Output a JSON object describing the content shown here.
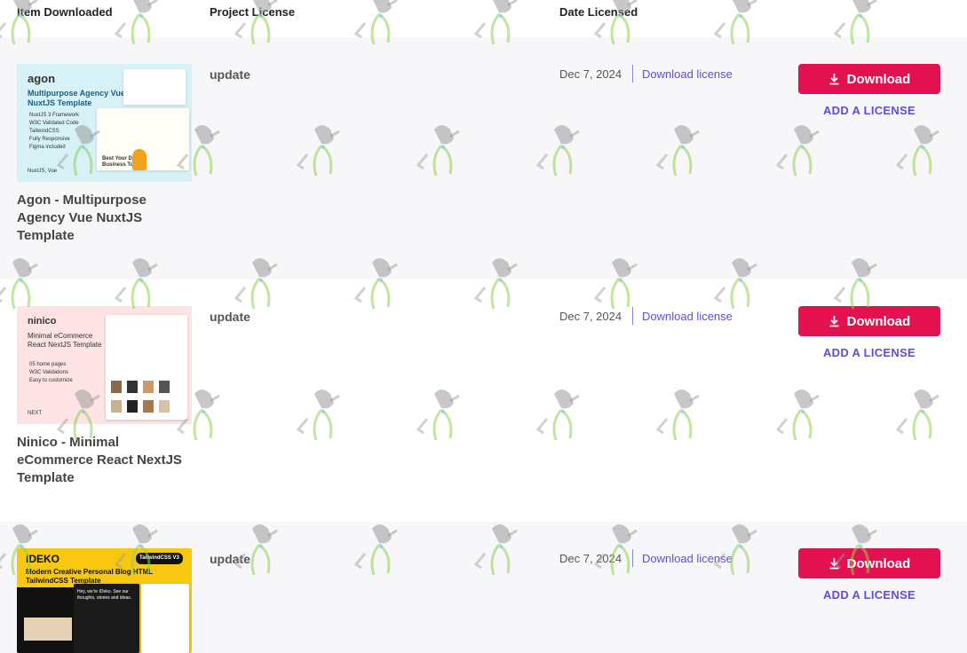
{
  "header": {
    "item_downloaded": "Item Downloaded",
    "project_license": "Project License",
    "date_licensed": "Date Licensed"
  },
  "rows": [
    {
      "title": "Agon - Multipurpose Agency Vue NuxtJS Template",
      "license_type": "update",
      "date": "Dec 7, 2024",
      "download_license": "Download license",
      "download_button": "Download",
      "add_license": "ADD A LICENSE",
      "thumb": {
        "brand": "agon",
        "heading": "Multipurpose Agency Vue NuxtJS Template",
        "bullets": [
          "NuxtJS 3 Framework",
          "W3C Validated Code",
          "TailwindCSS",
          "Fully Responsive",
          "Figma included"
        ],
        "footer": "NuxtJS, Vue",
        "card_text": "Best Your Dream Business Today"
      }
    },
    {
      "title": "Ninico - Minimal eCommerce React NextJS Template",
      "license_type": "update",
      "date": "Dec 7, 2024",
      "download_license": "Download license",
      "download_button": "Download",
      "add_license": "ADD A LICENSE",
      "thumb": {
        "brand": "ninico",
        "heading": "Minimal eCommerce React NextJS Template",
        "bullets": [
          "05 home pages",
          "W3C Validations",
          "Easy to customize"
        ],
        "footer": "NEXT"
      }
    },
    {
      "title": "",
      "license_type": "update",
      "date": "Dec 7, 2024",
      "download_license": "Download license",
      "download_button": "Download",
      "add_license": "ADD A LICENSE",
      "thumb": {
        "brand": "IDEKO",
        "badge": "TailwindCSS V3",
        "heading": "Modern Creative Personal Blog HTML TailwindCSS Template",
        "intro": "Hey, we're IDeko. See our thoughts, stories and ideas."
      }
    }
  ],
  "colors": {
    "accent": "#e3114f",
    "link": "#5b4fd8",
    "row_shade": "#f7f7fa"
  },
  "icons": {
    "download": "download-icon",
    "watermark": "watering-can-plant-icon"
  }
}
